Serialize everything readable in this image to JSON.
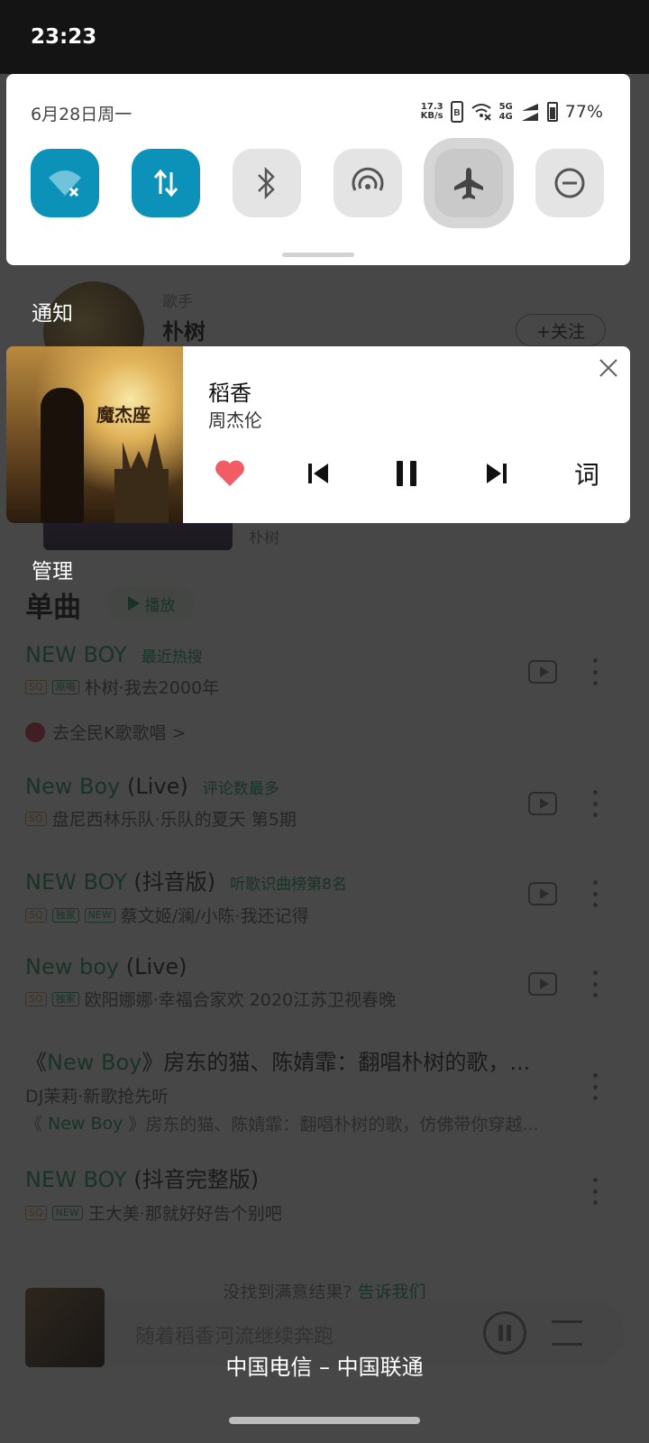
{
  "status_bar": {
    "time": "23:23"
  },
  "quick_settings": {
    "date": "6月28日周一",
    "net_speed_value": "17.3",
    "net_speed_unit": "KB/s",
    "network_top": "5G",
    "network_bottom": "4G",
    "battery": "77%",
    "tiles": [
      {
        "name": "wifi",
        "state": "on"
      },
      {
        "name": "mobile-data",
        "state": "on"
      },
      {
        "name": "bluetooth",
        "state": "off"
      },
      {
        "name": "hotspot",
        "state": "off"
      },
      {
        "name": "airplane-mode",
        "state": "pressed"
      },
      {
        "name": "do-not-disturb",
        "state": "off"
      }
    ],
    "accent_color": "#0c92b8"
  },
  "labels": {
    "notifications": "通知",
    "manage": "管理"
  },
  "media": {
    "title": "稻香",
    "artist": "周杰伦",
    "album_art_text": "魔杰座",
    "lyrics_button": "词",
    "liked": true
  },
  "background_app": {
    "artist_role": "歌手",
    "artist_name": "朴树",
    "follow_label": "+关注",
    "album_artist": "朴树",
    "singles_heading": "单曲",
    "play_label": "播放",
    "ksong_label": "去全民K歌歌唱 >",
    "songs": [
      {
        "title": "NEW BOY",
        "title_suffix": "",
        "tag": "最近热搜",
        "badges": [
          "SQ",
          "原唱"
        ],
        "sub": "朴树·我去2000年"
      },
      {
        "title": "New Boy",
        "title_suffix": " (Live)",
        "tag": "评论数最多",
        "badges": [
          "SQ"
        ],
        "sub": "盘尼西林乐队·乐队的夏天 第5期"
      },
      {
        "title": "NEW BOY",
        "title_suffix": " (抖音版)",
        "tag": "听歌识曲榜第8名",
        "badges": [
          "SQ",
          "独家",
          "NEW"
        ],
        "sub": "蔡文姬/澜/小陈·我还记得"
      },
      {
        "title": "New boy",
        "title_suffix": " (Live)",
        "tag": "",
        "badges": [
          "SQ",
          "独家"
        ],
        "sub": "欧阳娜娜·幸福合家欢 2020江苏卫视春晚"
      },
      {
        "title_prefix": "《",
        "title": "New Boy",
        "title_suffix": "》房东的猫、陈婧霏：翻唱朴树的歌，...",
        "tag": "",
        "badges": [],
        "sub": "DJ茉莉·新歌抢先听",
        "sub2_prefix": "《",
        "sub2_highlight": "New Boy",
        "sub2_rest": "》房东的猫、陈婧霏：翻唱朴树的歌，仿佛带你穿越..."
      },
      {
        "title": "NEW BOY",
        "title_suffix": " (抖音完整版)",
        "tag": "",
        "badges": [
          "SQ",
          "NEW"
        ],
        "sub": "王大美·那就好好告个别吧"
      }
    ],
    "not_found_text": "没找到满意结果?",
    "not_found_link": "告诉我们",
    "mini_player_lyric": "随着稻香河流继续奔跑"
  },
  "carrier": "中国电信 – 中国联通"
}
